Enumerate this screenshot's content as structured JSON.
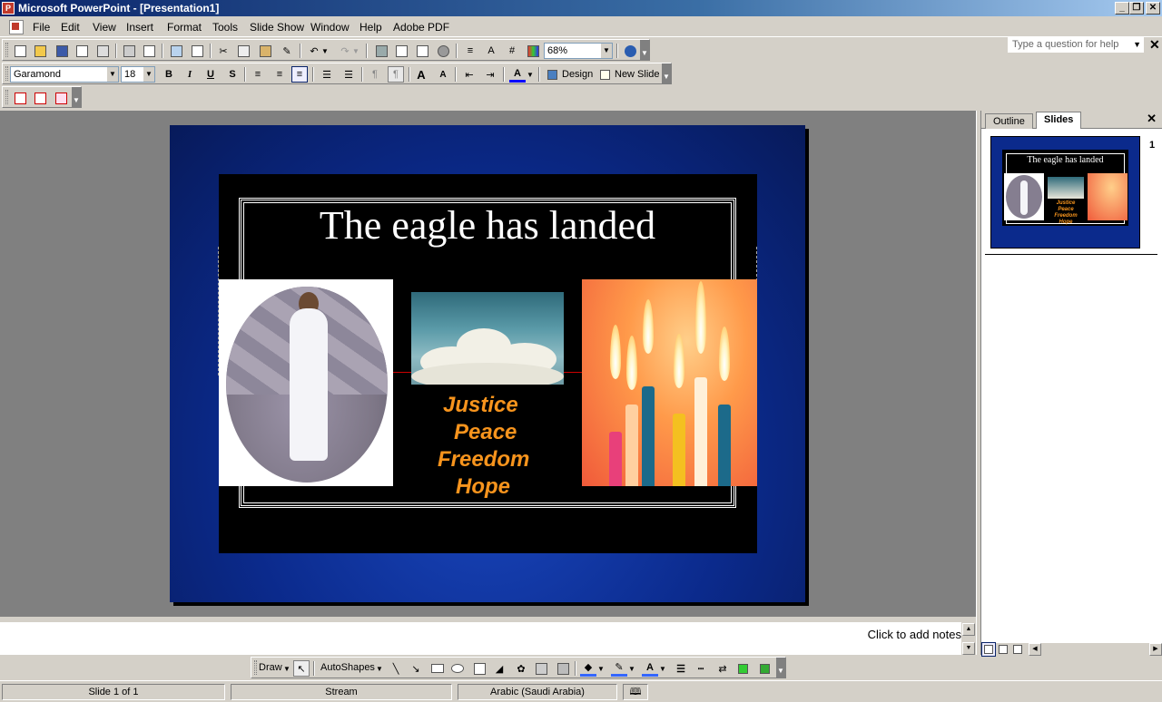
{
  "window": {
    "title": "Microsoft PowerPoint - [Presentation1]",
    "minimize": "_",
    "restore": "❐",
    "close": "✕"
  },
  "menu": {
    "items": [
      "File",
      "Edit",
      "View",
      "Insert",
      "Format",
      "Tools",
      "Slide Show",
      "Window",
      "Help",
      "Adobe PDF"
    ],
    "help_placeholder": "Type a question for help",
    "close": "✕"
  },
  "toolbar_standard": {
    "zoom": "68%"
  },
  "toolbar_formatting": {
    "font": "Garamond",
    "size": "18",
    "bold": "B",
    "italic": "I",
    "underline": "U",
    "shadow": "S",
    "design": "Design",
    "new_slide": "New Slide"
  },
  "slide": {
    "title": "The eagle has landed",
    "values": [
      "Justice",
      "Peace",
      "Freedom",
      "Hope"
    ]
  },
  "panel": {
    "tab_outline": "Outline",
    "tab_slides": "Slides",
    "close": "✕",
    "thumb_number": "1",
    "thumb_title": "The eagle has landed"
  },
  "notes": {
    "placeholder": "Click to add notes"
  },
  "drawing": {
    "draw": "Draw",
    "autoshapes": "AutoShapes"
  },
  "status": {
    "slide": "Slide 1 of 1",
    "design": "Stream",
    "language": "Arabic (Saudi Arabia)"
  },
  "colors": {
    "title_bar": "#0a246a",
    "value_text": "#f7941d",
    "slide_bg": "#0b2a8c"
  }
}
